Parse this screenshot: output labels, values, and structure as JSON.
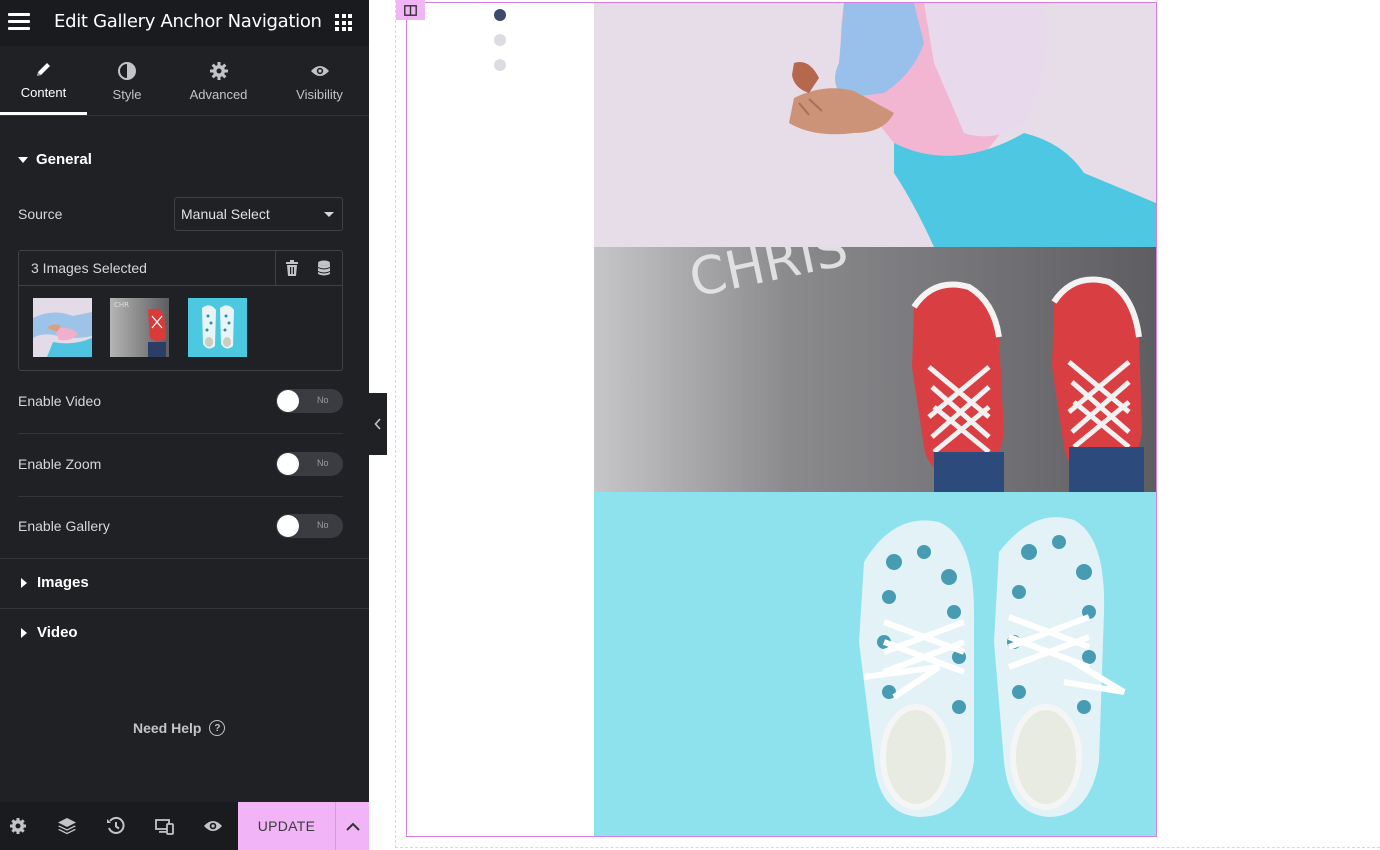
{
  "header": {
    "title": "Edit Gallery Anchor Navigation"
  },
  "tabs": [
    {
      "label": "Content",
      "icon": "pencil-icon"
    },
    {
      "label": "Style",
      "icon": "half-circle-icon"
    },
    {
      "label": "Advanced",
      "icon": "gear-icon"
    },
    {
      "label": "Visibility",
      "icon": "eye-icon"
    }
  ],
  "general": {
    "title": "General",
    "source_label": "Source",
    "source_value": "Manual Select",
    "gallery_count": "3 Images Selected",
    "enable_video": {
      "label": "Enable Video",
      "state": "No"
    },
    "enable_zoom": {
      "label": "Enable Zoom",
      "state": "No"
    },
    "enable_gallery": {
      "label": "Enable Gallery",
      "state": "No"
    }
  },
  "sections": {
    "images": "Images",
    "video": "Video"
  },
  "help": {
    "label": "Need Help",
    "icon": "?"
  },
  "footer": {
    "update_label": "UPDATE"
  },
  "colors": {
    "accent": "#f0b4f7",
    "panel_bg": "#1f2124",
    "active_dot": "#3d4a6b",
    "inactive_dot": "#dcdde2"
  },
  "nav_dots": {
    "count": 3,
    "active_index": 0
  }
}
